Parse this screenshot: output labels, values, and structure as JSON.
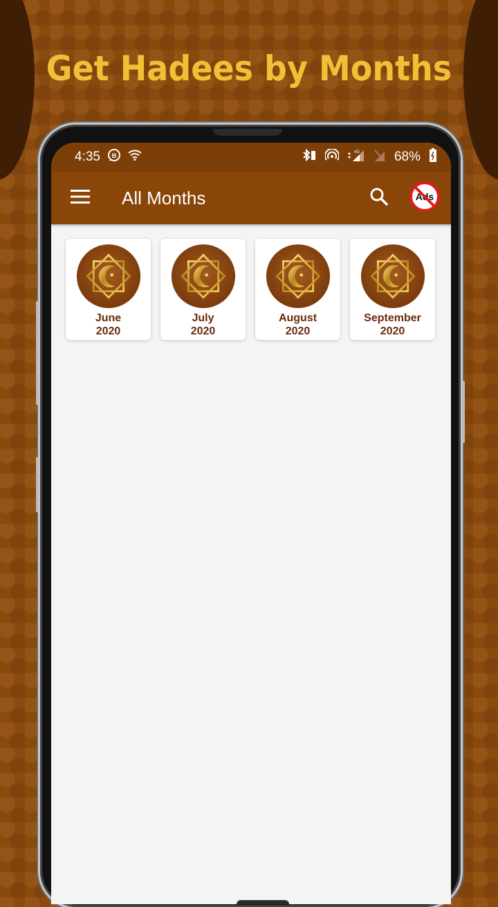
{
  "promo": {
    "title": "Get Hadees by Months"
  },
  "status_bar": {
    "time": "4:35",
    "left_icons": [
      "beeline-app-icon",
      "wifi-icon"
    ],
    "right_icons": [
      "bluetooth-icon",
      "hotspot-icon",
      "signal-4g-icon",
      "no-sim-icon",
      "battery-icon"
    ],
    "battery": "68%",
    "network": "4G"
  },
  "app_bar": {
    "title": "All Months",
    "menu_icon": "hamburger-menu-icon",
    "search_icon": "search-icon",
    "no_ads_icon": "no-ads-icon",
    "no_ads_text": "Ads"
  },
  "months": [
    {
      "month": "June",
      "year": "2020"
    },
    {
      "month": "July",
      "year": "2020"
    },
    {
      "month": "August",
      "year": "2020"
    },
    {
      "month": "September",
      "year": "2020"
    }
  ],
  "colors": {
    "primary": "#8a4509",
    "status_bar": "#7d3f08",
    "accent_text": "#6b2a0a",
    "promo_title": "#f2c036",
    "background": "#f4f4f4"
  }
}
